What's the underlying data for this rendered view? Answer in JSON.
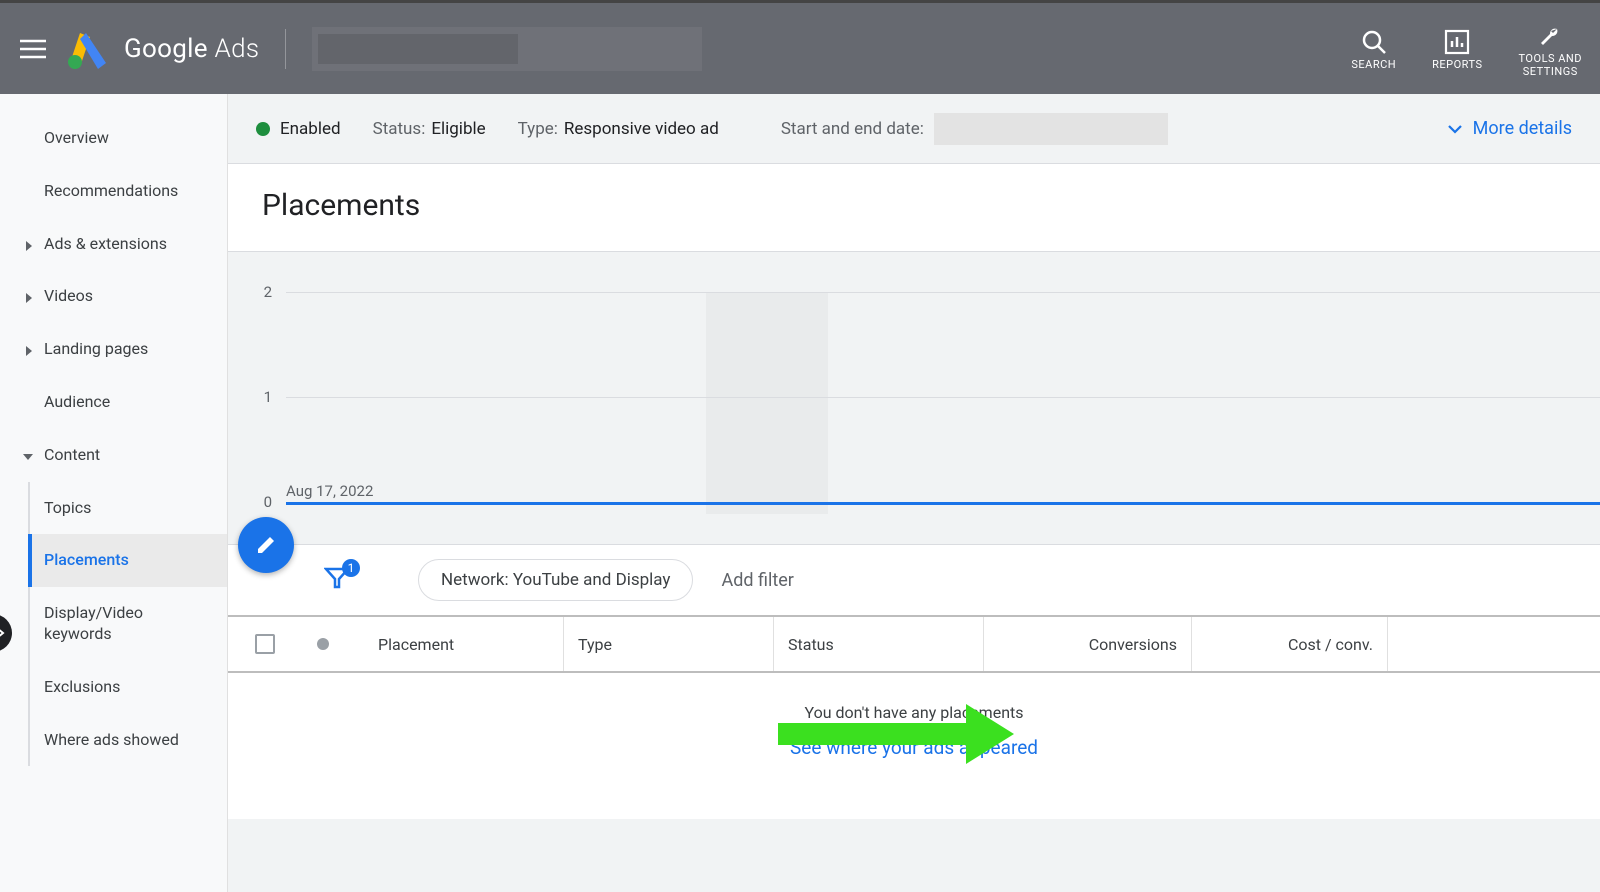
{
  "header": {
    "logo_text_1": "Google",
    "logo_text_2": " Ads",
    "actions": {
      "search": "SEARCH",
      "reports": "REPORTS",
      "tools": "TOOLS AND\nSETTINGS"
    }
  },
  "sidebar": {
    "overview": "Overview",
    "recommendations": "Recommendations",
    "ads_extensions": "Ads & extensions",
    "videos": "Videos",
    "landing_pages": "Landing pages",
    "audience": "Audience",
    "content": "Content",
    "content_children": {
      "topics": "Topics",
      "placements": "Placements",
      "display_video_kw": "Display/Video keywords",
      "exclusions": "Exclusions",
      "where_ads_showed": "Where ads showed"
    }
  },
  "statusbar": {
    "enabled": "Enabled",
    "status_label": "Status: ",
    "status_value": "Eligible",
    "type_label": "Type: ",
    "type_value": "Responsive video ad",
    "date_label": "Start and end date:",
    "more_details": "More details"
  },
  "page_title": "Placements",
  "chart_data": {
    "type": "line",
    "title": "",
    "xlabel": "",
    "ylabel": "",
    "ylim": [
      0,
      2
    ],
    "yticks": [
      "0",
      "1",
      "2"
    ],
    "x_start_label": "Aug 17, 2022",
    "series": [],
    "values": []
  },
  "filter": {
    "chip": "Network: YouTube and Display",
    "add_filter": "Add filter",
    "badge": "1"
  },
  "table": {
    "columns": {
      "placement": "Placement",
      "type": "Type",
      "status": "Status",
      "conversions": "Conversions",
      "cost_conv": "Cost / conv."
    }
  },
  "empty": {
    "message": "You don't have any placements",
    "link": "See where your ads appeared"
  }
}
